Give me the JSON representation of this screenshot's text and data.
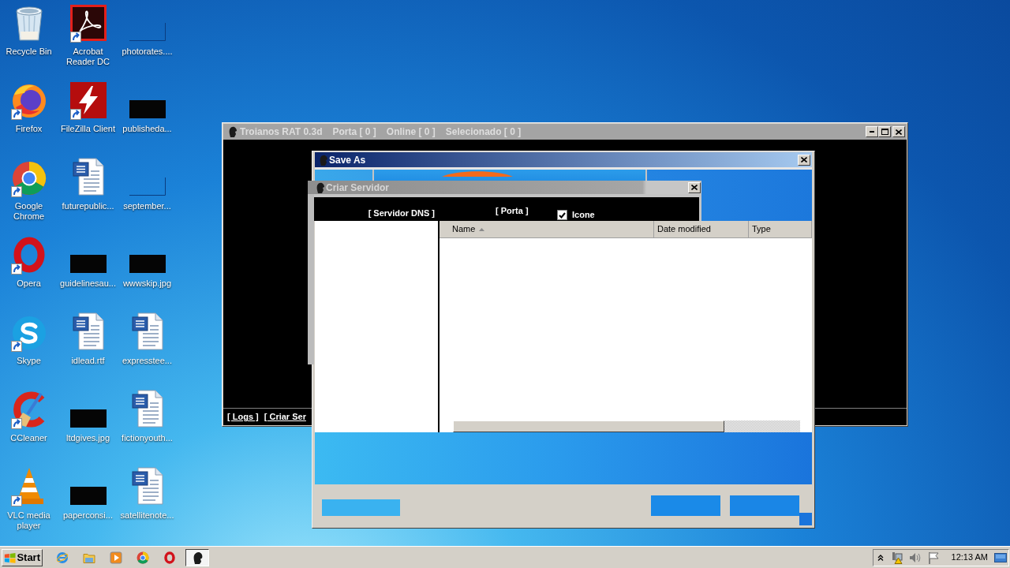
{
  "desktop": {
    "icons": [
      {
        "label": "Recycle Bin",
        "kind": "recycle",
        "shortcut": false
      },
      {
        "label": "Acrobat Reader DC",
        "kind": "acrobat",
        "shortcut": true
      },
      {
        "label": "photorates....",
        "kind": "blank",
        "shortcut": false
      },
      {
        "label": "Firefox",
        "kind": "firefox",
        "shortcut": true
      },
      {
        "label": "FileZilla Client",
        "kind": "filezilla",
        "shortcut": true
      },
      {
        "label": "publisheda...",
        "kind": "black",
        "shortcut": false
      },
      {
        "label": "Google Chrome",
        "kind": "chrome",
        "shortcut": true
      },
      {
        "label": "futurepublic...",
        "kind": "word",
        "shortcut": false
      },
      {
        "label": "september...",
        "kind": "blank",
        "shortcut": false
      },
      {
        "label": "Opera",
        "kind": "opera",
        "shortcut": true
      },
      {
        "label": "guidelinesau...",
        "kind": "black",
        "shortcut": false
      },
      {
        "label": "wwwskip.jpg",
        "kind": "black",
        "shortcut": false
      },
      {
        "label": "Skype",
        "kind": "skype",
        "shortcut": true
      },
      {
        "label": "idlead.rtf",
        "kind": "word",
        "shortcut": false
      },
      {
        "label": "expresstee...",
        "kind": "word",
        "shortcut": false
      },
      {
        "label": "CCleaner",
        "kind": "ccleaner",
        "shortcut": true
      },
      {
        "label": "ltdgives.jpg",
        "kind": "black",
        "shortcut": false
      },
      {
        "label": "fictionyouth...",
        "kind": "word",
        "shortcut": false
      },
      {
        "label": "VLC media player",
        "kind": "vlc",
        "shortcut": true
      },
      {
        "label": "paperconsi...",
        "kind": "black",
        "shortcut": false
      },
      {
        "label": "satellitenote...",
        "kind": "word",
        "shortcut": false
      }
    ]
  },
  "main_window": {
    "title": "Troianos RAT 0.3d",
    "active": false,
    "counters": [
      "Porta [ 0 ]",
      "Online [ 0 ]",
      "Selecionado [ 0 ]"
    ],
    "links": [
      "[ Logs ]",
      "[ Criar Ser"
    ]
  },
  "save_dialog": {
    "title": "Save As",
    "columns": [
      {
        "label": "Name",
        "sorted": true
      },
      {
        "label": "Date modified",
        "sorted": false
      },
      {
        "label": "Type",
        "sorted": false
      }
    ]
  },
  "server_dialog": {
    "title": "Criar Servidor",
    "labels": [
      "[ Servidor DNS ]",
      "[ Porta ]"
    ],
    "icon_option": {
      "label": "Icone",
      "checked": true
    }
  },
  "taskbar": {
    "start": "Start",
    "quick_launch": [
      {
        "kind": "ie"
      },
      {
        "kind": "explorer"
      },
      {
        "kind": "media"
      },
      {
        "kind": "chrome"
      },
      {
        "kind": "opera"
      }
    ],
    "tasks": [
      {
        "kind": "rat",
        "selected": true
      }
    ],
    "clock": "12:13 AM"
  }
}
